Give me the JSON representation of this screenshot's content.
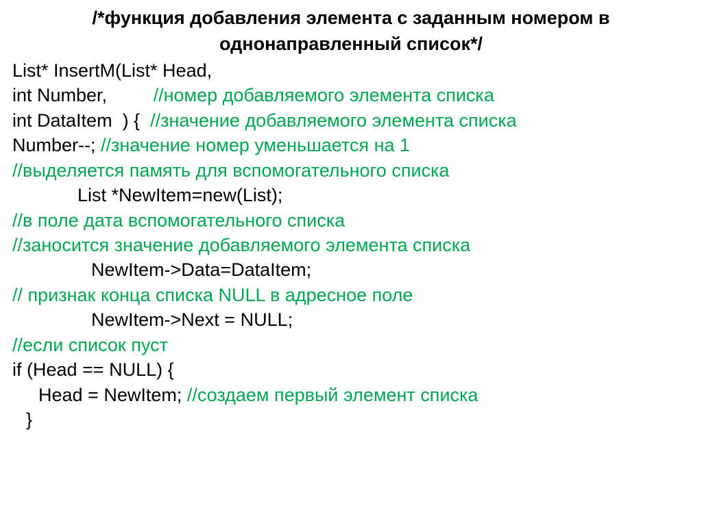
{
  "header": {
    "line1": "/*функция добавления элемента с заданным номером в",
    "line2": "однонаправленный список*/"
  },
  "lines": {
    "l1_code": "List* InsertM(List* Head,",
    "l2_code": "int Number,         ",
    "l2_comment": "//номер добавляемого элемента списка",
    "l3_code": "int DataItem  ) {  ",
    "l3_comment": "//значение добавляемого элемента списка",
    "l4_code": "Number--; ",
    "l4_comment": "//значение номер уменьшается на 1",
    "l5_comment": "//выделяется память для вспомогательного списка",
    "l6_code": "List *NewItem=new(List);",
    "l7_comment": "//в поле дата вспомогательного списка",
    "l8_comment": "//заносится значение добавляемого элемента списка",
    "l9_code": "NewItem->Data=DataItem;",
    "l10_comment": "// признак конца списка NULL в адресное поле",
    "l11_code": "NewItem->Next = NULL;",
    "l12_comment": "//если список пуст",
    "l13_code": "if (Head == NULL) {",
    "l14_code": "Head = NewItem; ",
    "l14_comment": "//создаем первый элемент списка",
    "l15_code": "}"
  }
}
